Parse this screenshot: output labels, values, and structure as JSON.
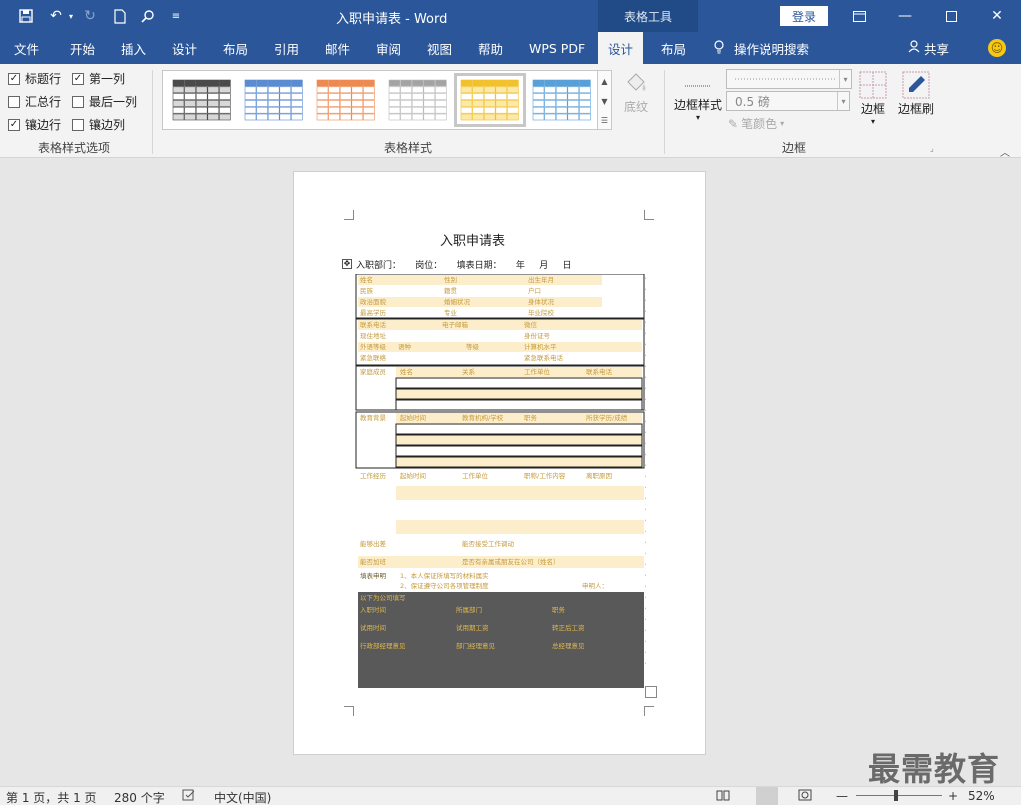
{
  "titlebar": {
    "doc_title": "入职申请表 - Word",
    "context_tab": "表格工具",
    "login": "登录"
  },
  "tabs": [
    "文件",
    "开始",
    "插入",
    "设计",
    "布局",
    "引用",
    "邮件",
    "审阅",
    "视图",
    "帮助",
    "WPS PDF",
    "设计",
    "布局"
  ],
  "tell_me": "操作说明搜索",
  "share": "共享",
  "style_options": {
    "label": "表格样式选项",
    "items": [
      {
        "label": "标题行",
        "checked": true
      },
      {
        "label": "第一列",
        "checked": true
      },
      {
        "label": "汇总行",
        "checked": false
      },
      {
        "label": "最后一列",
        "checked": false
      },
      {
        "label": "镶边行",
        "checked": true
      },
      {
        "label": "镶边列",
        "checked": false
      }
    ]
  },
  "table_styles": {
    "label": "表格样式",
    "shading": "底纹",
    "colors": [
      "#4a4a4a",
      "#5b8bd0",
      "#ed8a52",
      "#a3a3a3",
      "#f2c12e",
      "#5aa0d8"
    ]
  },
  "borders": {
    "label": "边框",
    "border_styles": "边框样式",
    "weight": "0.5 磅",
    "pen_color": "笔颜色",
    "border_btn": "边框",
    "border_painter": "边框刷"
  },
  "document": {
    "title": "入职申请表",
    "header_line": "入职部门：     岗位：     填表日期：     年     月     日",
    "rows": [
      [
        "姓名",
        "性别",
        "出生年月"
      ],
      [
        "民族",
        "籍贯",
        "户口"
      ],
      [
        "政治面貌",
        "婚姻状况",
        "身体状况"
      ],
      [
        "最高学历",
        "专业",
        "毕业院校"
      ],
      [
        "联系电话",
        "电子邮箱",
        "微信"
      ],
      [
        "现住地址",
        "",
        "身份证号"
      ],
      [
        "外语等级",
        "语种",
        "等级",
        "计算机水平"
      ],
      [
        "紧急联络",
        "",
        "紧急联系电话"
      ],
      [
        "家庭成员",
        "姓名",
        "关系",
        "工作单位",
        "联系电话"
      ],
      [
        "教育背景",
        "起始时间",
        "教育机构/学校",
        "职务",
        "所获学历/成绩"
      ],
      [
        "工作经历",
        "起始时间",
        "工作单位",
        "职称/工作内容",
        "离职原因"
      ],
      [
        "能够出差",
        "能否接受工作调动"
      ],
      [
        "能否加班",
        "是否有亲属或朋友在公司（姓名）"
      ],
      [
        "填表申明",
        "1、本人保证所填写的材料属实",
        "2、保证遵守公司各项管理制度",
        "申明人："
      ],
      [
        "以下为公司填写"
      ],
      [
        "入职时间",
        "所属部门",
        "职务"
      ],
      [
        "试用时间",
        "试用期工资",
        "转正后工资"
      ],
      [
        "行政部经理意见",
        "部门经理意见",
        "总经理意见"
      ]
    ]
  },
  "status": {
    "page": "第 1 页，共 1 页",
    "words": "280 个字",
    "lang": "中文(中国)",
    "zoom": "52%"
  },
  "watermark": "最需教育"
}
